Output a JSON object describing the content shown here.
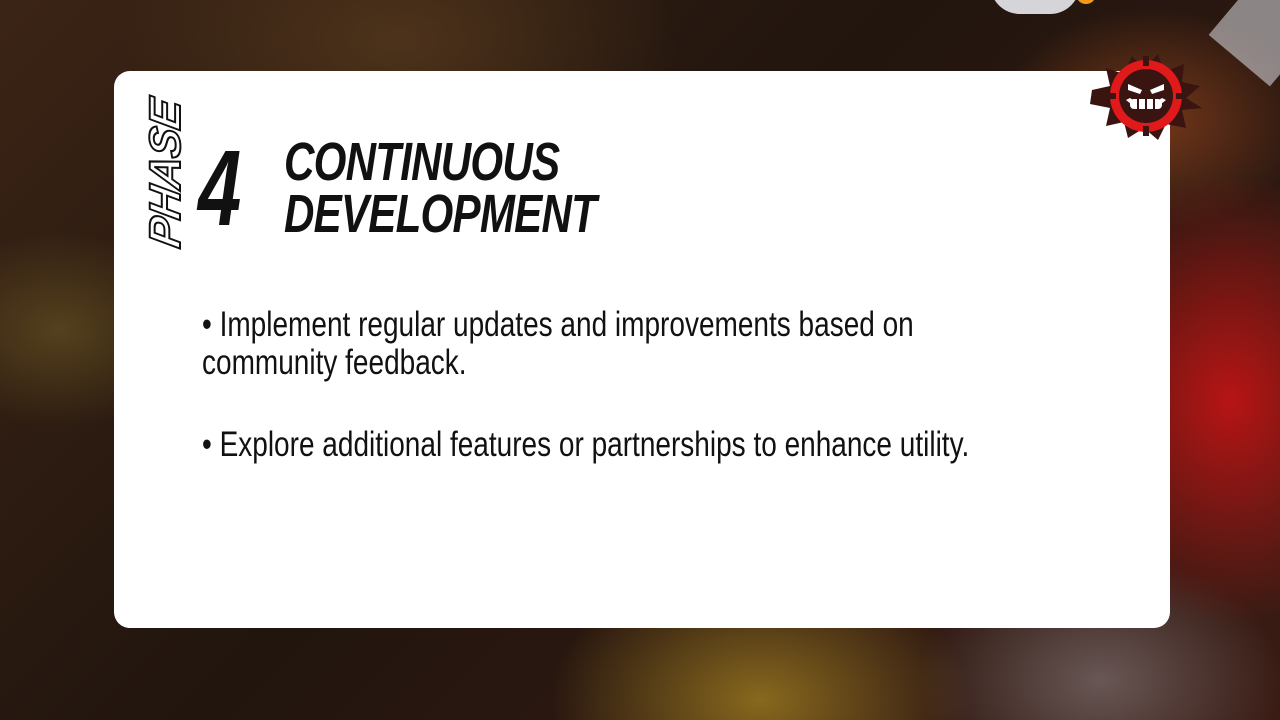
{
  "background": {
    "accent_red": "#be1414",
    "accent_gold": "#d2aa28"
  },
  "card": {
    "background": "#ffffff"
  },
  "phase": {
    "word": "PHASE",
    "number": "4",
    "title_line1": "CONTINUOUS",
    "title_line2": "DEVELOPMENT"
  },
  "bullets": [
    {
      "line1": "• Implement regular updates and improvements based on",
      "line2": "community feedback."
    },
    {
      "line1": "• Explore additional features or partnerships to enhance utility."
    }
  ],
  "badge": {
    "icon": "angry-grin-face-icon",
    "ring_color": "#e0191b",
    "face_color": "#3a1410"
  }
}
